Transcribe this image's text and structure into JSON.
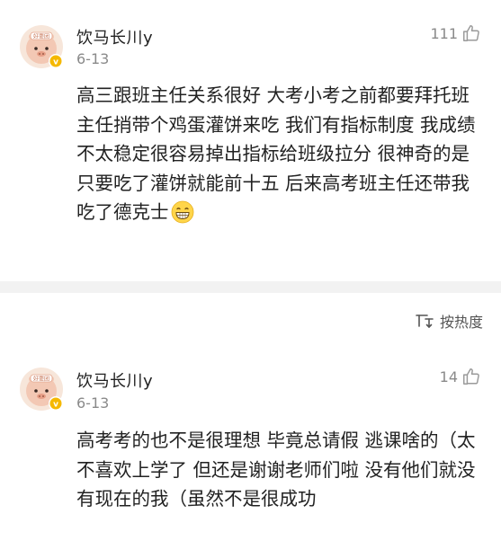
{
  "comments": [
    {
      "username": "饮马长川y",
      "date": "6-13",
      "likes": "111",
      "avatar_badge": "好耍团",
      "text": "高三跟班主任关系很好   大考小考之前都要拜托班主任捎带个鸡蛋灌饼来吃  我们有指标制度 我成绩不太稳定很容易掉出指标给班级拉分  很神奇的是 只要吃了灌饼就能前十五  后来高考班主任还带我吃了德克士",
      "emoji": "grin-emoji"
    },
    {
      "username": "饮马长川y",
      "date": "6-13",
      "likes": "14",
      "avatar_badge": "好耍团",
      "text": "高考考的也不是很理想 毕竟总请假 逃课啥的（太不喜欢上学了    但还是谢谢老师们啦  没有他们就没有现在的我（虽然不是很成功"
    }
  ],
  "sort": {
    "label": "按热度",
    "icon": "sort-icon"
  },
  "colors": {
    "text": "#222222",
    "meta": "#8a8a8a",
    "divider": "#f2f2f2",
    "verified_badge": "#f5b800"
  }
}
